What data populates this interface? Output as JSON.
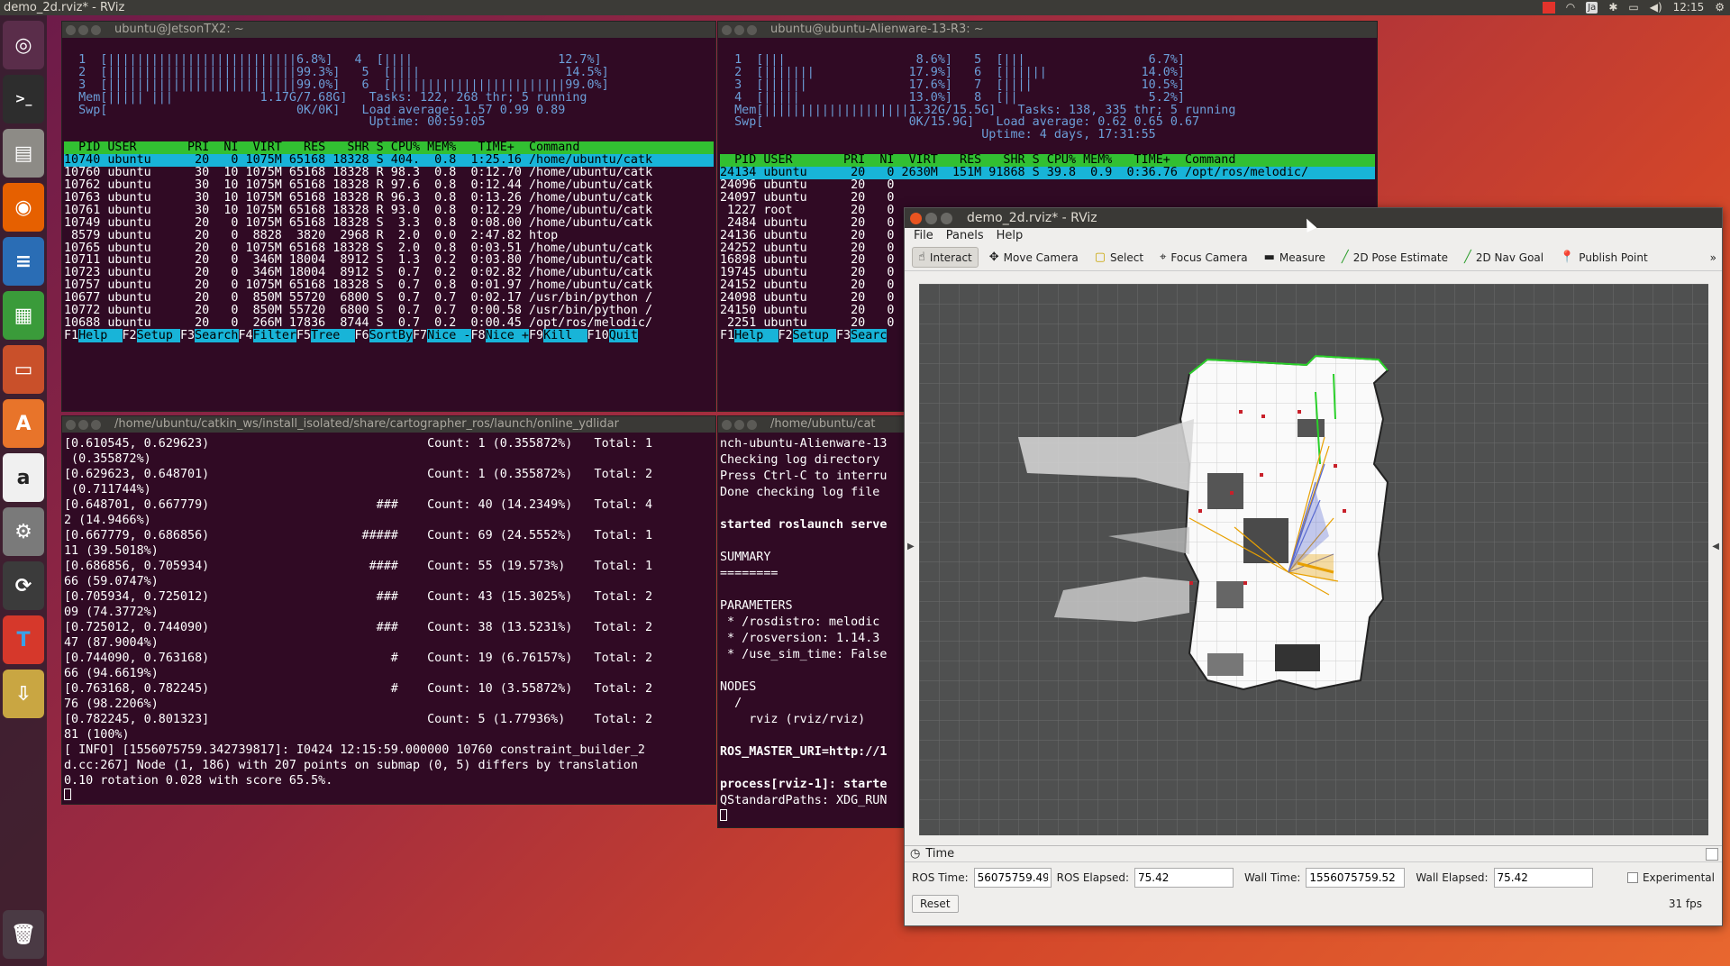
{
  "topbar": {
    "title": "demo_2d.rviz* - RViz",
    "keyboard": "Ja",
    "clock": "12:15"
  },
  "launcher": {
    "items": [
      "ubuntu-logo-icon",
      "terminal-icon",
      "files-icon",
      "firefox-icon",
      "writer-icon",
      "calc-icon",
      "impress-icon",
      "software-center-icon",
      "amazon-icon",
      "system-settings-icon",
      "updater-icon",
      "font-viewer-icon",
      "archive-icon",
      "trash-icon"
    ]
  },
  "term_tl": {
    "title": "ubuntu@JetsonTX2: ~",
    "cpu_lines": [
      "  1  [||||||||||||||||||||||||||6.8%]   4  [||||                    12.7%]",
      "  2  [||||||||||||||||||||||||||99.3%]   5  [||||                    14.5%]",
      "  3  [||||||||||||||||||||||||||99.0%]   6  [||||||||||||||||||||||||99.0%]"
    ],
    "mem_line": "  Mem[||||| |||            1.17G/7.68G]   Tasks: 122, 268 thr; 5 running",
    "swp_line": "  Swp[                          0K/0K]   Load average: 1.57 0.99 0.89",
    "uptime_line": "                                          Uptime: 00:59:05",
    "header": "  PID USER       PRI  NI  VIRT   RES   SHR S CPU% MEM%   TIME+  Command         ",
    "rows": [
      "10740 ubuntu      20   0 1075M 65168 18328 S 404.  0.8  1:25.16 /home/ubuntu/catk",
      "10760 ubuntu      30  10 1075M 65168 18328 R 98.3  0.8  0:12.70 /home/ubuntu/catk",
      "10762 ubuntu      30  10 1075M 65168 18328 R 97.6  0.8  0:12.44 /home/ubuntu/catk",
      "10763 ubuntu      30  10 1075M 65168 18328 R 96.3  0.8  0:13.26 /home/ubuntu/catk",
      "10761 ubuntu      30  10 1075M 65168 18328 R 93.0  0.8  0:12.29 /home/ubuntu/catk",
      "10749 ubuntu      20   0 1075M 65168 18328 S  3.3  0.8  0:08.00 /home/ubuntu/catk",
      " 8579 ubuntu      20   0  8828  3820  2968 R  2.0  0.0  2:47.82 htop",
      "10765 ubuntu      20   0 1075M 65168 18328 S  2.0  0.8  0:03.51 /home/ubuntu/catk",
      "10711 ubuntu      20   0  346M 18004  8912 S  1.3  0.2  0:03.80 /home/ubuntu/catk",
      "10723 ubuntu      20   0  346M 18004  8912 S  0.7  0.2  0:02.82 /home/ubuntu/catk",
      "10757 ubuntu      20   0 1075M 65168 18328 S  0.7  0.8  0:01.97 /home/ubuntu/catk",
      "10677 ubuntu      20   0  850M 55720  6800 S  0.7  0.7  0:02.17 /usr/bin/python /",
      "10772 ubuntu      20   0  850M 55720  6800 S  0.7  0.7  0:00.58 /usr/bin/python /",
      "10688 ubuntu      20   0  266M 17836  8744 S  0.7  0.2  0:00.45 /opt/ros/melodic/"
    ],
    "fkeys": [
      [
        "F1",
        "Help  "
      ],
      [
        "F2",
        "Setup "
      ],
      [
        "F3",
        "Search"
      ],
      [
        "F4",
        "Filter"
      ],
      [
        "F5",
        "Tree  "
      ],
      [
        "F6",
        "SortBy"
      ],
      [
        "F7",
        "Nice -"
      ],
      [
        "F8",
        "Nice +"
      ],
      [
        "F9",
        "Kill  "
      ],
      [
        "F10",
        "Quit"
      ]
    ]
  },
  "term_tr": {
    "title": "ubuntu@ubuntu-Alienware-13-R3: ~",
    "cpu_lines": [
      "  1  [|||                  8.6%]   5  [|||                 6.7%]",
      "  2  [|||||||             17.9%]   6  [||||||             14.0%]",
      "  3  [||||||              17.6%]   7  [||||               10.5%]",
      "  4  [|||||               13.0%]   8  [||                  5.2%]"
    ],
    "mem_line": "  Mem[||||||||||||||||||||1.32G/15.5G]   Tasks: 138, 335 thr; 5 running",
    "swp_line": "  Swp[                    0K/15.9G]   Load average: 0.62 0.65 0.67",
    "uptime_line": "                                    Uptime: 4 days, 17:31:55",
    "header": "  PID USER       PRI  NI  VIRT   RES   SHR S CPU% MEM%   TIME+  Command",
    "rows": [
      "24134 ubuntu      20   0 2630M  151M 91868 S 39.8  0.9  0:36.76 /opt/ros/melodic/",
      "24096 ubuntu      20   0",
      "24097 ubuntu      20   0",
      " 1227 root        20   0",
      " 2484 ubuntu      20   0",
      "24136 ubuntu      20   0",
      "24252 ubuntu      20   0",
      "16898 ubuntu      20   0",
      "19745 ubuntu      20   0",
      "24152 ubuntu      20   0",
      "24098 ubuntu      20   0",
      "24150 ubuntu      20   0",
      " 2251 ubuntu      20   0"
    ],
    "fkeys": [
      [
        "F1",
        "Help  "
      ],
      [
        "F2",
        "Setup "
      ],
      [
        "F3",
        "Searc"
      ]
    ]
  },
  "term_bl": {
    "title": "/home/ubuntu/catkin_ws/install_isolated/share/cartographer_ros/launch/online_ydlidar",
    "lines": [
      "[0.610545, 0.629623)                              Count: 1 (0.355872%)   Total: 1",
      " (0.355872%)",
      "[0.629623, 0.648701)                              Count: 1 (0.355872%)   Total: 2",
      " (0.711744%)",
      "[0.648701, 0.667779)                       ###    Count: 40 (14.2349%)   Total: 4",
      "2 (14.9466%)",
      "[0.667779, 0.686856)                     #####    Count: 69 (24.5552%)   Total: 1",
      "11 (39.5018%)",
      "[0.686856, 0.705934)                      ####    Count: 55 (19.573%)    Total: 1",
      "66 (59.0747%)",
      "[0.705934, 0.725012)                       ###    Count: 43 (15.3025%)   Total: 2",
      "09 (74.3772%)",
      "[0.725012, 0.744090)                       ###    Count: 38 (13.5231%)   Total: 2",
      "47 (87.9004%)",
      "[0.744090, 0.763168)                         #    Count: 19 (6.76157%)   Total: 2",
      "66 (94.6619%)",
      "[0.763168, 0.782245)                         #    Count: 10 (3.55872%)   Total: 2",
      "76 (98.2206%)",
      "[0.782245, 0.801323]                              Count: 5 (1.77936%)    Total: 2",
      "81 (100%)",
      "[ INFO] [1556075759.342739817]: I0424 12:15:59.000000 10760 constraint_builder_2",
      "d.cc:267] Node (1, 186) with 207 points on submap (0, 5) differs by translation",
      "0.10 rotation 0.028 with score 65.5%."
    ]
  },
  "term_bm": {
    "title": "/home/ubuntu/cat",
    "lines": [
      "nch-ubuntu-Alienware-13",
      "Checking log directory",
      "Press Ctrl-C to interru",
      "Done checking log file",
      "",
      "started roslaunch serve",
      "",
      "SUMMARY",
      "========",
      "",
      "PARAMETERS",
      " * /rosdistro: melodic",
      " * /rosversion: 1.14.3",
      " * /use_sim_time: False",
      "",
      "NODES",
      "  /",
      "    rviz (rviz/rviz)",
      "",
      "ROS_MASTER_URI=http://1",
      "",
      "process[rviz-1]: starte",
      "QStandardPaths: XDG_RUN"
    ]
  },
  "rviz": {
    "title": "demo_2d.rviz* - RViz",
    "menu": [
      "File",
      "Panels",
      "Help"
    ],
    "tools": [
      {
        "icon": "interact-icon",
        "label": "Interact"
      },
      {
        "icon": "move-camera-icon",
        "label": "Move Camera"
      },
      {
        "icon": "select-icon",
        "label": "Select"
      },
      {
        "icon": "focus-camera-icon",
        "label": "Focus Camera"
      },
      {
        "icon": "measure-icon",
        "label": "Measure"
      },
      {
        "icon": "pose-estimate-icon",
        "label": "2D Pose Estimate"
      },
      {
        "icon": "nav-goal-icon",
        "label": "2D Nav Goal"
      },
      {
        "icon": "publish-point-icon",
        "label": "Publish Point"
      }
    ],
    "time_panel": {
      "title": "Time",
      "ros_time_label": "ROS Time:",
      "ros_time": "56075759.49",
      "ros_elapsed_label": "ROS Elapsed:",
      "ros_elapsed": "75.42",
      "wall_time_label": "Wall Time:",
      "wall_time": "1556075759.52",
      "wall_elapsed_label": "Wall Elapsed:",
      "wall_elapsed": "75.42",
      "experimental_label": "Experimental",
      "reset_label": "Reset",
      "fps": "31 fps"
    }
  }
}
